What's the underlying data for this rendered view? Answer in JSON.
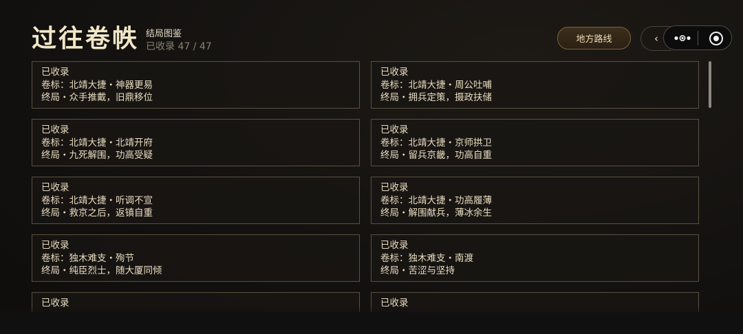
{
  "header": {
    "title": "过往卷帙",
    "subtitle": "结局图鉴",
    "count": "已收录 47 / 47",
    "region_button": "地方路线",
    "back_glyph": "‹"
  },
  "cards": [
    {
      "status": "已收录",
      "tag": "卷标：北靖大捷・神器更易",
      "ending": "终局・众手推戴，旧鼎移位"
    },
    {
      "status": "已收录",
      "tag": "卷标：北靖大捷・周公吐哺",
      "ending": "终局・拥兵定策，摄政扶储"
    },
    {
      "status": "已收录",
      "tag": "卷标：北靖大捷・北靖开府",
      "ending": "终局・九死解围，功高受疑"
    },
    {
      "status": "已收录",
      "tag": "卷标：北靖大捷・京师拱卫",
      "ending": "终局・留兵京畿，功高自重"
    },
    {
      "status": "已收录",
      "tag": "卷标：北靖大捷・听调不宣",
      "ending": "终局・救京之后，返镇自重"
    },
    {
      "status": "已收录",
      "tag": "卷标：北靖大捷・功高履薄",
      "ending": "终局・解围献兵，薄冰余生"
    },
    {
      "status": "已收录",
      "tag": "卷标：独木难支・殉节",
      "ending": "终局・纯臣烈士，随大厦同倾"
    },
    {
      "status": "已收录",
      "tag": "卷标：独木难支・南渡",
      "ending": "终局・苦涩与坚持"
    },
    {
      "status": "已收录",
      "tag": "",
      "ending": ""
    },
    {
      "status": "已收录",
      "tag": "",
      "ending": ""
    }
  ]
}
